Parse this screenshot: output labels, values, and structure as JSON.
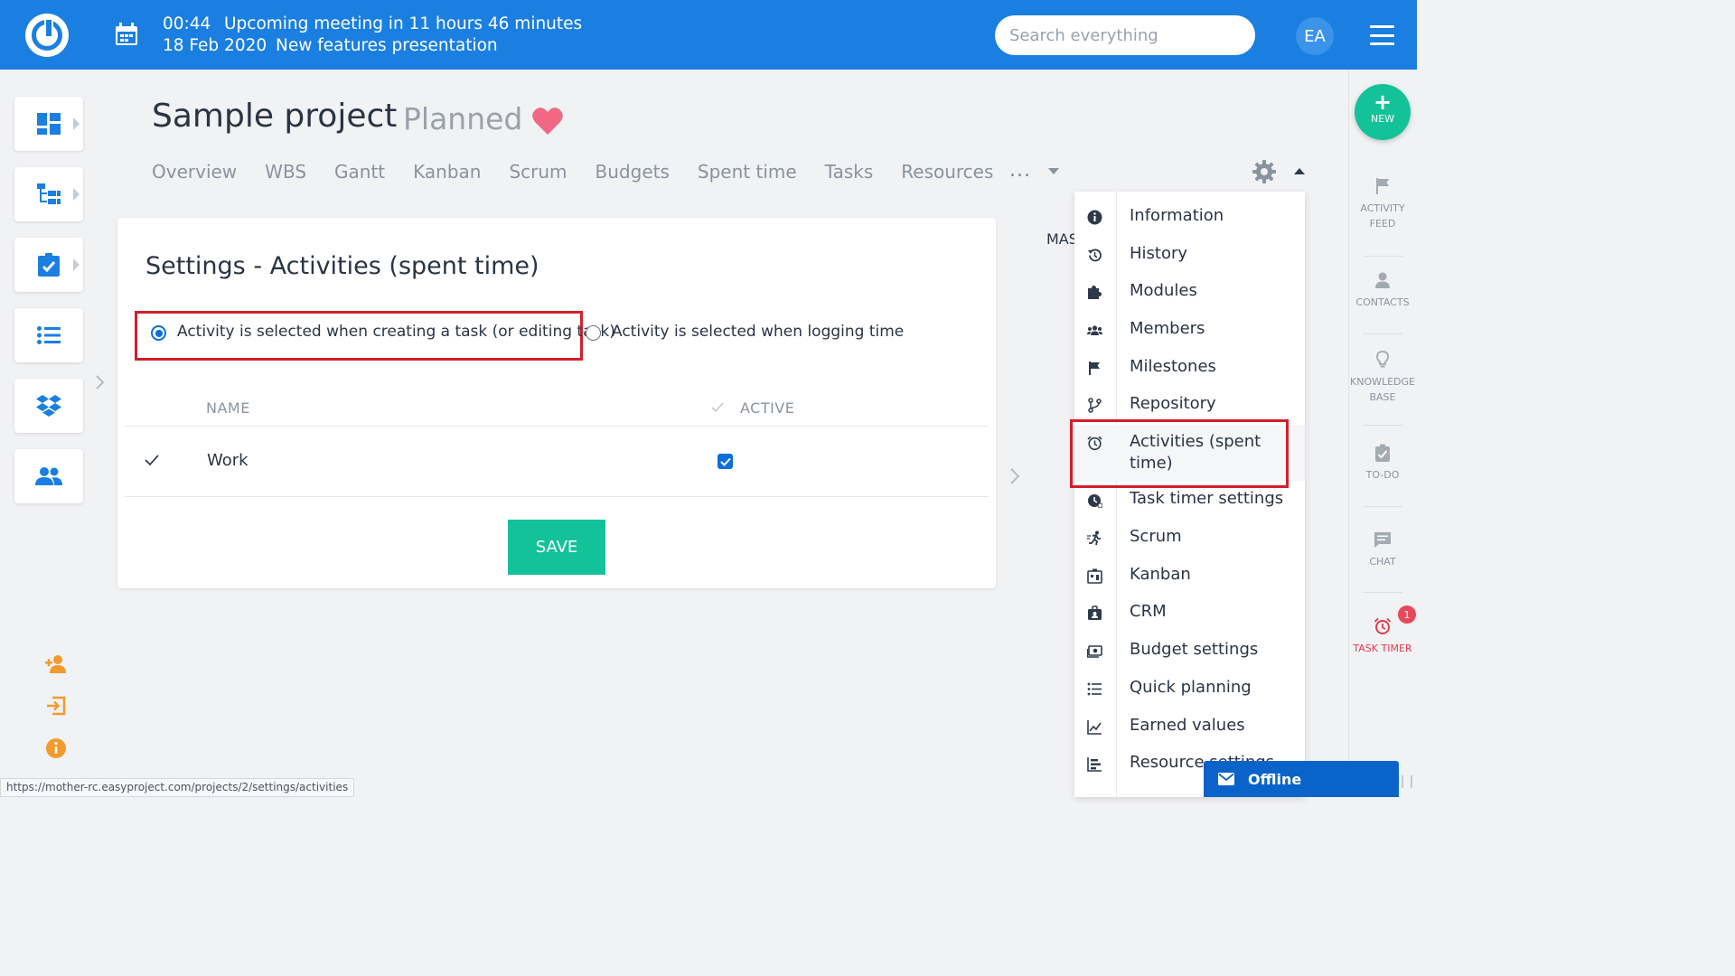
{
  "topbar": {
    "meeting_time": "00:44",
    "meeting_date": "18 Feb 2020",
    "meeting_title": "Upcoming meeting in 11 hours 46 minutes",
    "meeting_subtitle": "New features presentation",
    "search_placeholder": "Search everything",
    "avatar_initials": "EA"
  },
  "project": {
    "title": "Sample project",
    "status": "Planned",
    "tabs": [
      "Overview",
      "WBS",
      "Gantt",
      "Kanban",
      "Scrum",
      "Budgets",
      "Spent time",
      "Tasks",
      "Resources"
    ],
    "more": "..."
  },
  "settings": {
    "title": "Settings - Activities (spent time)",
    "option1": "Activity is selected when creating a task (or editing task)",
    "option2": "Activity is selected when logging time",
    "selected_option": 1,
    "col_name": "NAME",
    "col_active": "ACTIVE",
    "rows": [
      {
        "name": "Work",
        "active": true
      }
    ],
    "save_label": "SAVE"
  },
  "side_partial_text": "MAS",
  "menu": {
    "items": [
      {
        "label": "Information",
        "icon": "info-icon"
      },
      {
        "label": "History",
        "icon": "history-icon"
      },
      {
        "label": "Modules",
        "icon": "puzzle-icon"
      },
      {
        "label": "Members",
        "icon": "members-icon"
      },
      {
        "label": "Milestones",
        "icon": "flag-icon"
      },
      {
        "label": "Repository",
        "icon": "branch-icon"
      },
      {
        "label": "Activities (spent time)",
        "icon": "alarm-icon"
      },
      {
        "label": "Task timer settings",
        "icon": "timer-icon"
      },
      {
        "label": "Scrum",
        "icon": "runner-icon"
      },
      {
        "label": "Kanban",
        "icon": "kanban-icon"
      },
      {
        "label": "CRM",
        "icon": "briefcase-icon"
      },
      {
        "label": "Budget settings",
        "icon": "money-icon"
      },
      {
        "label": "Quick planning",
        "icon": "list-icon"
      },
      {
        "label": "Earned values",
        "icon": "chart-icon"
      },
      {
        "label": "Resource settings",
        "icon": "resource-icon"
      }
    ],
    "active_index": 6
  },
  "right_sidebar": {
    "new_label": "NEW",
    "items": [
      {
        "label": "ACTIVITY FEED",
        "icon": "flag-icon"
      },
      {
        "label": "CONTACTS",
        "icon": "person-icon"
      },
      {
        "label": "KNOWLEDGE BASE",
        "icon": "lightbulb-icon"
      },
      {
        "label": "TO-DO",
        "icon": "clipboard-check-icon"
      },
      {
        "label": "CHAT",
        "icon": "chat-icon"
      },
      {
        "label": "TASK TIMER",
        "icon": "alarm-icon"
      }
    ],
    "timer_badge": "1"
  },
  "status_url": "https://mother-rc.easyproject.com/projects/2/settings/activities",
  "offline_label": "Offline",
  "colors": {
    "brand": "#1a7fe0",
    "accent": "#14c29a",
    "highlight": "#d0202c",
    "timer": "#e23a4e"
  }
}
